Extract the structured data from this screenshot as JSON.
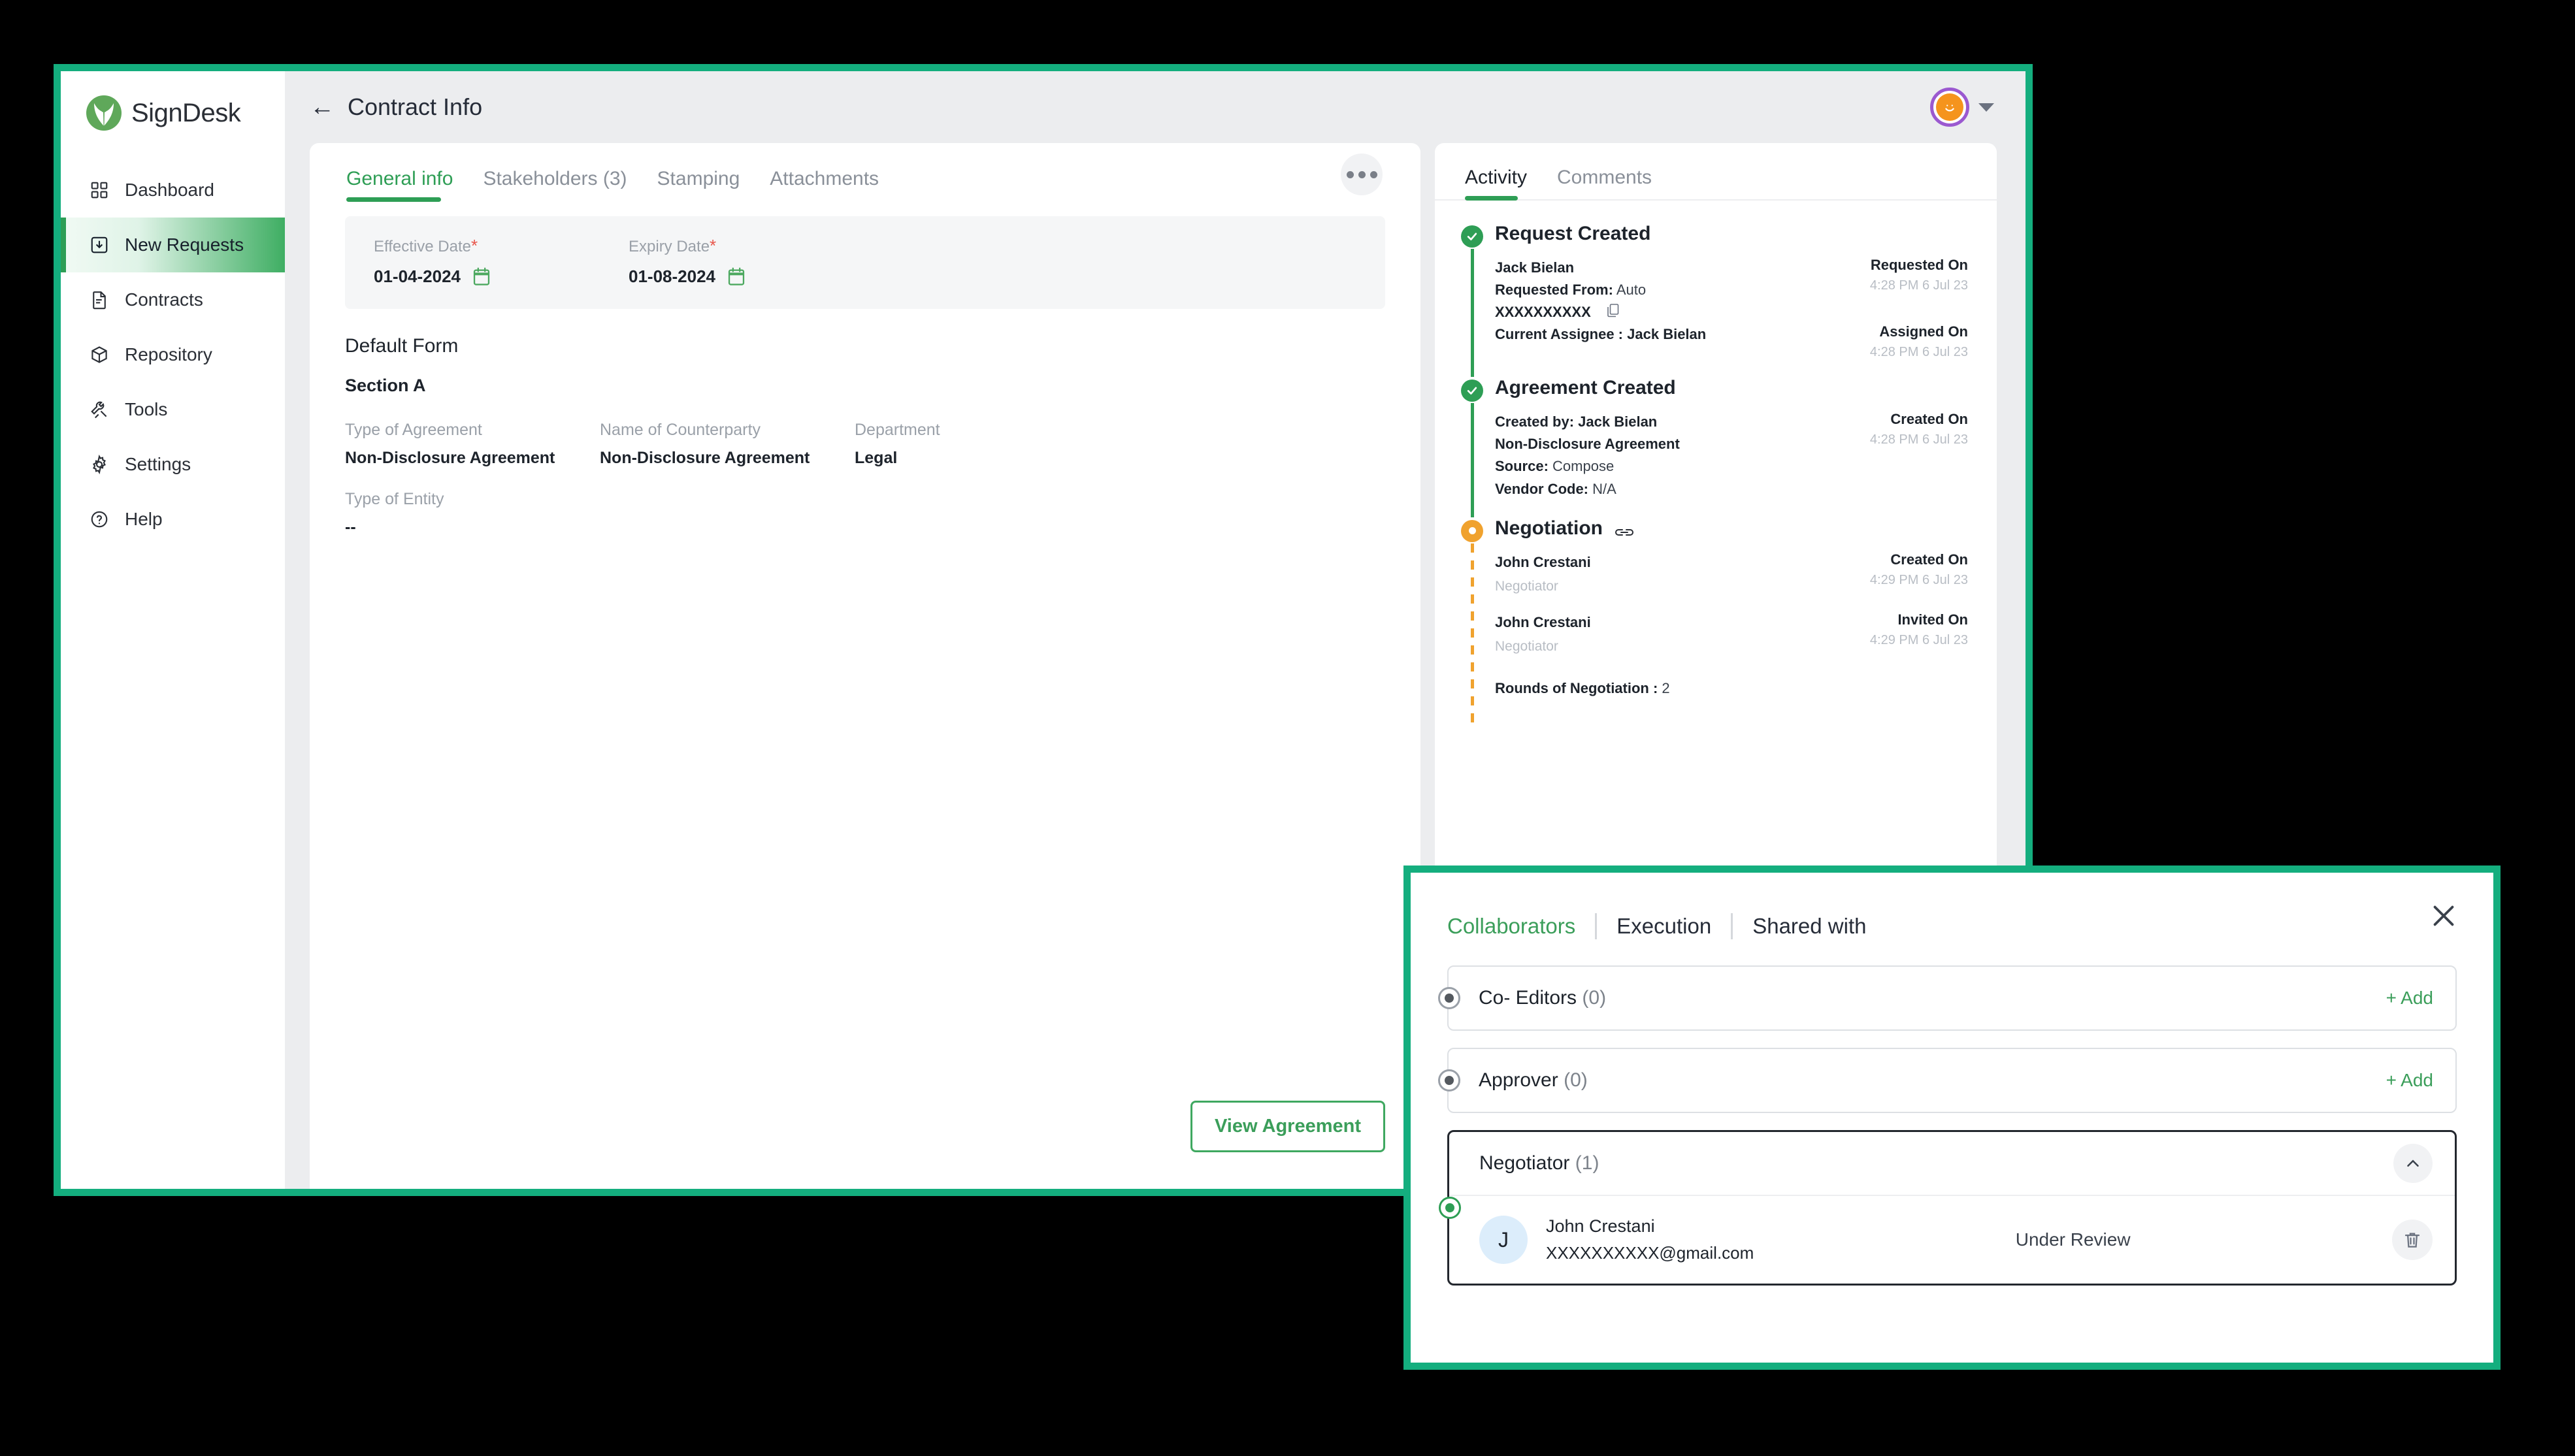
{
  "brand": {
    "name": "SignDesk"
  },
  "sidebar": {
    "items": [
      {
        "label": "Dashboard",
        "icon": "grid-icon",
        "active": false
      },
      {
        "label": "New Requests",
        "icon": "inbox-download-icon",
        "active": true
      },
      {
        "label": "Contracts",
        "icon": "document-icon",
        "active": false
      },
      {
        "label": "Repository",
        "icon": "box-icon",
        "active": false
      },
      {
        "label": "Tools",
        "icon": "tools-icon",
        "active": false
      },
      {
        "label": "Settings",
        "icon": "gear-icon",
        "active": false
      },
      {
        "label": "Help",
        "icon": "question-circle-icon",
        "active": false
      }
    ]
  },
  "topbar": {
    "back_arrow": "←",
    "title": "Contract Info",
    "avatar_initial": "☺"
  },
  "main": {
    "tabs": [
      {
        "label": "General info",
        "active": true
      },
      {
        "label": "Stakeholders (3)",
        "active": false
      },
      {
        "label": "Stamping",
        "active": false
      },
      {
        "label": "Attachments",
        "active": false
      }
    ],
    "dates": [
      {
        "label": "Effective Date",
        "required": "*",
        "value": "01-04-2024"
      },
      {
        "label": "Expiry Date",
        "required": "*",
        "value": "01-08-2024"
      }
    ],
    "form_title": "Default Form",
    "section_title": "Section A",
    "fields_row1": [
      {
        "label": "Type of Agreement",
        "value": "Non-Disclosure Agreement"
      },
      {
        "label": "Name of Counterparty",
        "value": "Non-Disclosure Agreement"
      },
      {
        "label": "Department",
        "value": "Legal"
      }
    ],
    "fields_row2": [
      {
        "label": "Type of Entity",
        "value": "--"
      }
    ],
    "view_agreement_label": "View Agreement"
  },
  "activity": {
    "tabs": [
      {
        "label": "Activity",
        "active": true
      },
      {
        "label": "Comments",
        "active": false
      }
    ],
    "events": [
      {
        "title": "Request Created",
        "marker": "green",
        "line": "solid",
        "rows": [
          {
            "left_name": "Jack Bielan",
            "left_lines": [
              {
                "label": "Requested From:",
                "value": "Auto"
              },
              {
                "label": "XXXXXXXXXX",
                "value": "",
                "copy": true
              }
            ],
            "right_label": "Requested On",
            "right_time": "4:28 PM 6 Jul 23"
          },
          {
            "left_name": "",
            "left_lines": [
              {
                "label": "Current Assignee :",
                "value": "Jack Bielan",
                "bold_value": true
              }
            ],
            "right_label": "Assigned On",
            "right_time": "4:28 PM 6 Jul 23"
          }
        ]
      },
      {
        "title": "Agreement Created",
        "marker": "green",
        "line": "solid",
        "rows": [
          {
            "left_name": "",
            "left_lines": [
              {
                "label": "Created by:",
                "value": "Jack Bielan",
                "bold_value": true
              },
              {
                "label": "Non-Disclosure Agreement",
                "value": "",
                "bold_value": true
              },
              {
                "label": "Source:",
                "value": "Compose"
              },
              {
                "label": "Vendor Code:",
                "value": "N/A"
              }
            ],
            "right_label": "Created On",
            "right_time": "4:28 PM 6 Jul 23"
          }
        ]
      },
      {
        "title": "Negotiation",
        "marker": "orange",
        "line": "dashed",
        "has_link_icon": true,
        "rows": [
          {
            "left_name": "John Crestani",
            "left_sub": "Negotiator",
            "left_lines": [],
            "right_label": "Created On",
            "right_time": "4:29 PM 6 Jul 23"
          },
          {
            "left_name": "John Crestani",
            "left_sub": "Negotiator",
            "left_lines": [],
            "right_label": "Invited On",
            "right_time": "4:29 PM 6 Jul 23"
          },
          {
            "left_name": "",
            "left_lines": [
              {
                "label": "Rounds of Negotiation :",
                "value": "2"
              }
            ],
            "right_label": "",
            "right_time": ""
          }
        ]
      }
    ]
  },
  "modal": {
    "tabs": [
      {
        "label": "Collaborators",
        "active": true
      },
      {
        "label": "Execution",
        "active": false
      },
      {
        "label": "Shared with",
        "active": false
      }
    ],
    "sections": [
      {
        "title": "Co- Editors",
        "count": "(0)",
        "radio": "gray",
        "action_label": "+ Add",
        "expanded": false,
        "selected": false
      },
      {
        "title": "Approver",
        "count": "(0)",
        "radio": "gray",
        "action_label": "+ Add",
        "expanded": false,
        "selected": false
      },
      {
        "title": "Negotiator",
        "count": "(1)",
        "radio": "green",
        "action_label": "",
        "expanded": true,
        "selected": true,
        "members": [
          {
            "initial": "J",
            "name": "John Crestani",
            "email": "XXXXXXXXXX@gmail.com",
            "status": "Under Review"
          }
        ]
      }
    ]
  },
  "colors": {
    "frame_teal": "#14AE7E",
    "brand_green": "#2E9E55",
    "accent_orange": "#F0A22E",
    "avatar_orange": "#F5941D",
    "avatar_ring_purple": "#9B59D0",
    "required_red": "#E8564B",
    "page_bg": "#ECEDEF"
  }
}
